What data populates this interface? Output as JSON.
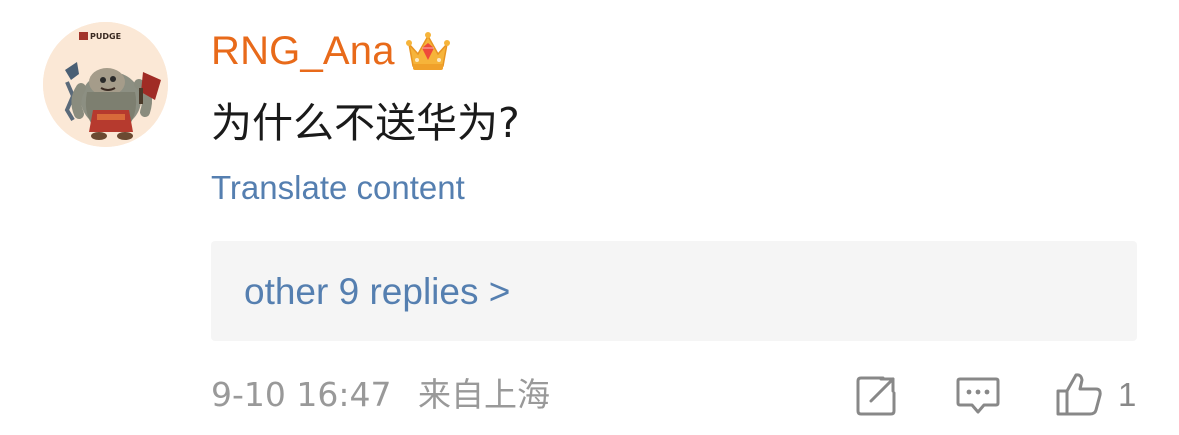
{
  "comment": {
    "username": "RNG_Ana",
    "badge_icon": "crown-icon",
    "avatar_badge_text": "PUDGE",
    "text": "为什么不送华为?",
    "translate_label": "Translate content",
    "replies_label": "other 9 replies >",
    "date": "9-10 16:47",
    "location": "来自上海",
    "like_count": "1"
  },
  "actions": {
    "share_icon": "share-icon",
    "reply_icon": "comment-icon",
    "like_icon": "thumbs-up-icon"
  },
  "colors": {
    "username": "#e86a1a",
    "link": "#557fb0",
    "meta": "#999999",
    "reply_box_bg": "#f5f5f5"
  }
}
